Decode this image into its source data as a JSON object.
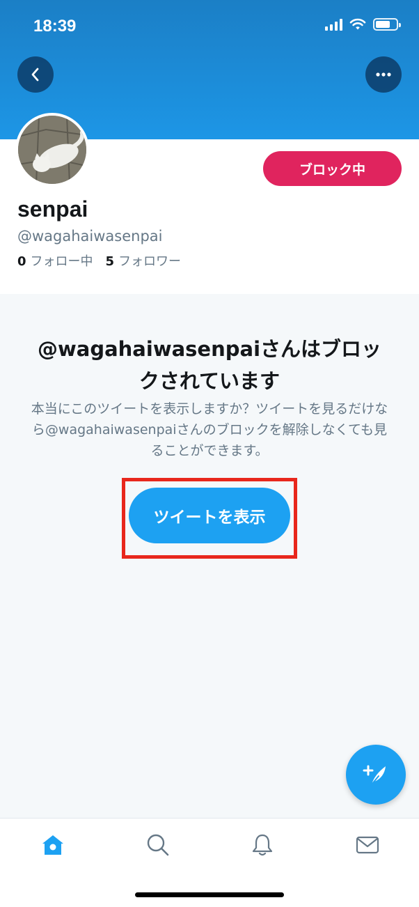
{
  "status_bar": {
    "time": "18:39"
  },
  "profile": {
    "block_button_label": "ブロック中",
    "display_name": "senpai",
    "handle": "@wagahaiwasenpai",
    "following_count": "0",
    "following_label": "フォロー中",
    "followers_count": "5",
    "followers_label": "フォロワー"
  },
  "blocked_notice": {
    "title": "@wagahaiwasenpaiさんはブロックされています",
    "description": "本当にこのツイートを表示しますか？ツイートを見るだけなら@wagahaiwasenpaiさんのブロックを解除しなくても見ることができます。",
    "show_button_label": "ツイートを表示"
  },
  "colors": {
    "accent": "#1da1f2",
    "block": "#e0245e",
    "highlight": "#e8271c"
  },
  "icons": {
    "back": "chevron-left-icon",
    "more": "more-horizontal-icon",
    "compose": "compose-tweet-icon",
    "tabs": [
      "home-icon",
      "search-icon",
      "bell-icon",
      "mail-icon"
    ]
  }
}
